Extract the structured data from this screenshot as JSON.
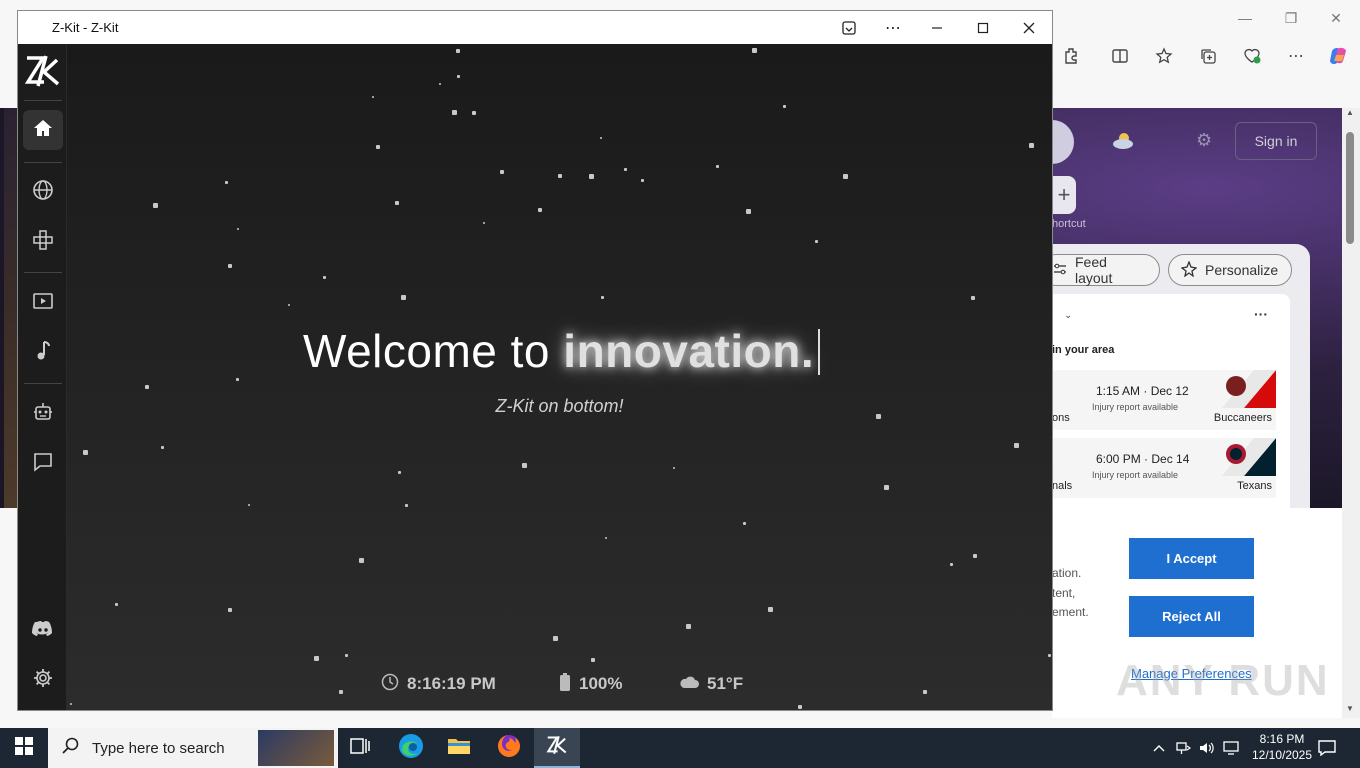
{
  "zkit": {
    "window_title": "Z-Kit - Z-Kit",
    "logo_text": "ZK",
    "headline_prefix": "Welcome to ",
    "headline_highlight": "innovation.",
    "subtitle": "Z-Kit on bottom!",
    "status": {
      "time": "8:16:19 PM",
      "battery": "100%",
      "weather": "51°F"
    },
    "sidebar": [
      {
        "name": "home",
        "icon": "home-icon",
        "active": true
      },
      {
        "name": "web",
        "icon": "globe-icon"
      },
      {
        "name": "games",
        "icon": "gamepad-icon"
      },
      {
        "name": "videos",
        "icon": "video-play-icon"
      },
      {
        "name": "music",
        "icon": "music-note-icon"
      },
      {
        "name": "ai",
        "icon": "robot-icon"
      },
      {
        "name": "chat",
        "icon": "chat-icon"
      },
      {
        "name": "discord",
        "icon": "discord-icon"
      },
      {
        "name": "settings",
        "icon": "gear-icon"
      }
    ]
  },
  "edge": {
    "sign_in": "Sign in",
    "add_shortcut": "hortcut",
    "feed_layout": "Feed layout",
    "personalize": "Personalize",
    "sports_label": "in your area",
    "games": [
      {
        "team_left": "ons",
        "time": "1:15 AM · Dec 12",
        "note": "Injury report available",
        "team_right": "Buccaneers"
      },
      {
        "team_left": "nals",
        "time": "6:00 PM · Dec 14",
        "note": "Injury report available",
        "team_right": "Texans"
      }
    ],
    "consent": {
      "line1": "ation.",
      "line2": "tent,",
      "line3": "ement.",
      "accept": "I Accept",
      "reject": "Reject All",
      "manage": "Manage Preferences"
    }
  },
  "watermark": "ANY RUN",
  "taskbar": {
    "search_placeholder": "Type here to search",
    "clock_time": "8:16 PM",
    "clock_date": "12/10/2025"
  },
  "colors": {
    "accent_blue": "#1f6fd0",
    "zkit_bg": "#1e1e1e",
    "taskbar": "#1d2733"
  }
}
